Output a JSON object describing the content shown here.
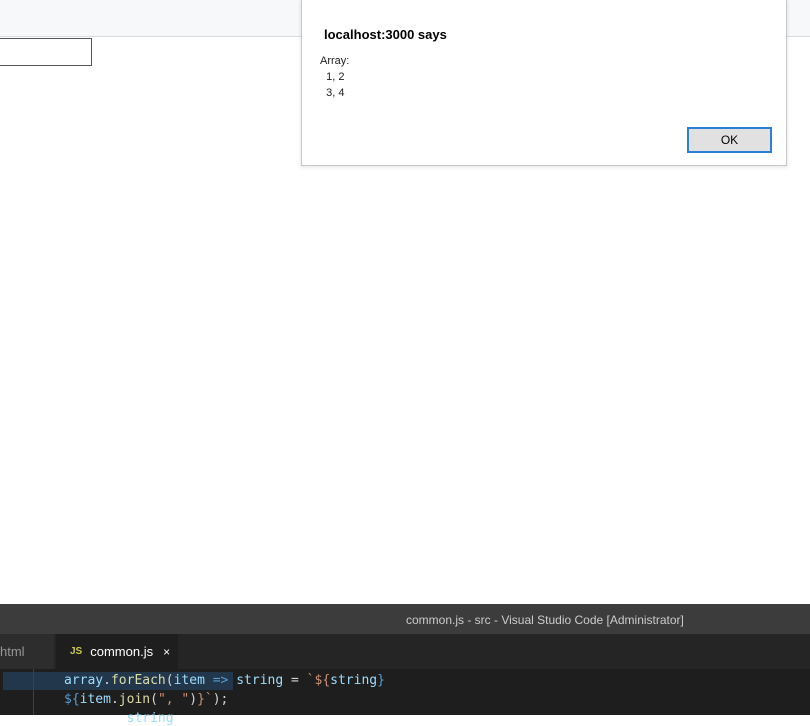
{
  "alert": {
    "title": "localhost:3000 says",
    "message_lines": [
      "Array:",
      "  1, 2",
      "  3, 4"
    ],
    "ok_label": "OK"
  },
  "vscode": {
    "window_title": "common.js - src - Visual Studio Code [Administrator]",
    "tabs": [
      {
        "label": "html",
        "active": false
      },
      {
        "label": "common.js",
        "active": true,
        "icon": "JS"
      }
    ],
    "close_glyph": "×",
    "code": {
      "line1": [
        "array",
        ".",
        "forEach",
        "(",
        "item",
        " => ",
        "string",
        " = ",
        "`${",
        "string",
        "}"
      ],
      "line2": [
        "${",
        "item",
        ".",
        "join",
        "(",
        "\", \"",
        ")",
        "}`",
        ");"
      ],
      "line3": "        string"
    }
  },
  "colors": {
    "accent_button_border": "#2b7fd4",
    "vscode_title_bg": "#3c3c3c",
    "editor_bg": "#1e1e1e"
  }
}
